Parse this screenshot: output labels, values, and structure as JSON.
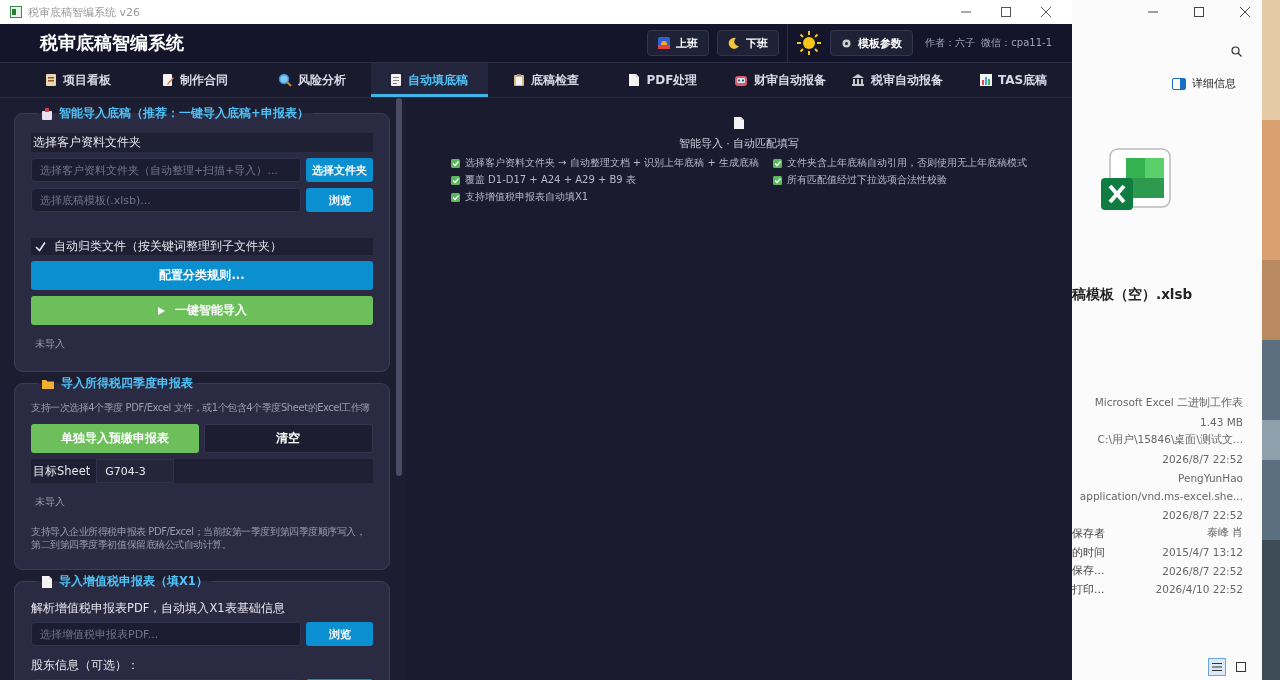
{
  "window": {
    "title": "税审底稿智编系统 v26"
  },
  "header": {
    "title": "税审底稿智编系统",
    "buttons": [
      {
        "kind": "sunrise",
        "label": "上班"
      },
      {
        "kind": "moon",
        "label": "下班"
      }
    ],
    "settings_button": {
      "label": "模板参数"
    },
    "author": "作者：六子  微信：cpa11-1"
  },
  "tabs": [
    {
      "kind": "board",
      "label": "项目看板",
      "selected": false
    },
    {
      "kind": "contract",
      "label": "制作合同",
      "selected": false
    },
    {
      "kind": "search",
      "label": "风险分析",
      "selected": false
    },
    {
      "kind": "memo",
      "label": "自动填底稿",
      "selected": true
    },
    {
      "kind": "clipboard",
      "label": "底稿检查",
      "selected": false
    },
    {
      "kind": "page",
      "label": "PDF处理",
      "selected": false
    },
    {
      "kind": "robot",
      "label": "财审自动报备",
      "selected": false
    },
    {
      "kind": "bank",
      "label": "税审自动报备",
      "selected": false
    },
    {
      "kind": "chart",
      "label": "TAS底稿",
      "selected": false
    }
  ],
  "groups": [
    {
      "kind": "package",
      "title": "智能导入底稿（推荐：一键导入底稿+申报表）",
      "items": [
        {
          "kind": "heading",
          "text": "选择客户资料文件夹"
        },
        {
          "kind": "file",
          "placeholder": "选择客户资料文件夹（自动整理+扫描+导入）...",
          "button": "选择文件夹"
        },
        {
          "kind": "file",
          "placeholder": "选择底稿模板(.xlsb)...",
          "button": "浏览"
        },
        {
          "kind": "checkbox",
          "label": "自动归类文件（按关键词整理到子文件夹）",
          "checked": true
        },
        {
          "kind": "primary_button",
          "label": "配置分类规则..."
        },
        {
          "kind": "play_button",
          "label": "一键智能导入"
        },
        {
          "kind": "status",
          "text": "未导入"
        }
      ]
    },
    {
      "kind": "folder",
      "title": "导入所得税四季度申报表",
      "items": [
        {
          "kind": "hint",
          "text": "支持一次选择4个季度 PDF/Excel 文件，或1个包含4个季度Sheet的Excel工作簿"
        },
        {
          "kind": "buttons",
          "buttons": [
            {
              "kind": "success",
              "label": "单独导入预缴申报表"
            },
            {
              "kind": "dark",
              "label": "清空"
            }
          ]
        },
        {
          "kind": "select",
          "label": "目标Sheet",
          "value": "G704-3"
        },
        {
          "kind": "status",
          "text": "未导入"
        },
        {
          "kind": "hint",
          "text": "支持导入企业所得税申报表 PDF/Excel；当前按第一季度到第四季度顺序写入，第二到第四季度季初值保留底稿公式自动计算。"
        }
      ]
    },
    {
      "kind": "page",
      "title": "导入增值税申报表（填X1）",
      "items": [
        {
          "kind": "text",
          "text": "解析增值税申报表PDF，自动填入X1表基础信息"
        },
        {
          "kind": "file",
          "placeholder": "选择增值税申报表PDF...",
          "button": "浏览"
        },
        {
          "kind": "text",
          "text": "股东信息（可选）："
        },
        {
          "kind": "file"
        }
      ]
    }
  ],
  "main": {
    "heading": "智能导入 · 自动匹配填写",
    "features": [
      "选择客户资料文件夹 → 自动整理文档 + 识别上年底稿 + 生成底稿",
      "文件夹含上年底稿自动引用，否则使用无上年底稿模式",
      "覆盖 D1-D17 + A24 + A29 + B9 表",
      "所有匹配值经过下拉选项合法性校验",
      "支持增值税申报表自动填X1"
    ]
  },
  "explorer": {
    "details_button": "详细信息",
    "file_name": "稿模板（空）.xlsb",
    "properties": [
      {
        "value": "Microsoft Excel 二进制工作表"
      },
      {
        "value": "1.43 MB"
      },
      {
        "value": "C:\\用户\\15846\\桌面\\测试文..."
      },
      {
        "value": "2026/8/7 22:52"
      },
      {
        "value": "PengYunHao"
      },
      {
        "value": "application/vnd.ms-excel.she..."
      },
      {
        "value": "2026/8/7 22:52"
      },
      {
        "label": "保存者",
        "value": "泰峰 肖"
      },
      {
        "label": "的时间",
        "value": "2015/4/7 13:12"
      },
      {
        "label": "保存...",
        "value": "2026/8/7 22:52"
      },
      {
        "label": "打印...",
        "value": "2026/4/10 22:52"
      }
    ],
    "view_buttons": [
      {
        "kind": "details",
        "selected": true
      },
      {
        "kind": "preview",
        "selected": false
      }
    ]
  }
}
